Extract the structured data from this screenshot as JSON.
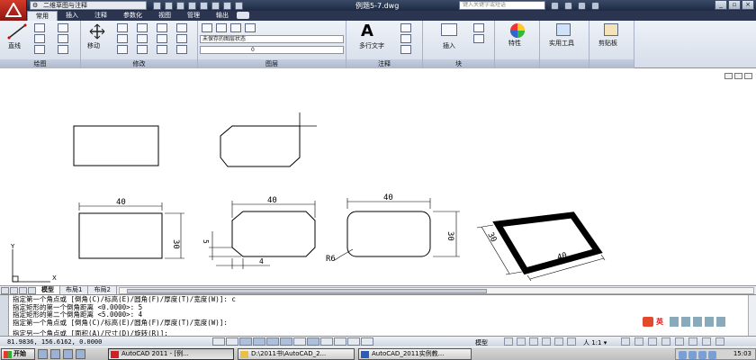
{
  "titlebar": {
    "workspace": "二维草图与注释",
    "document_title": "例题5-7.dwg",
    "search_placeholder": "键入关键字或短语"
  },
  "ribbon_tabs": [
    "常用",
    "插入",
    "注释",
    "参数化",
    "视图",
    "管理",
    "输出"
  ],
  "ribbon": {
    "draw_panel": {
      "label": "绘图",
      "line_label": "直线"
    },
    "modify_panel": {
      "label": "修改",
      "move_label": "移动"
    },
    "layer_panel": {
      "label": "图层",
      "state_combo": "未保存的图层状态",
      "layer_combo": "0"
    },
    "annotation_panel": {
      "label": "注释",
      "mtext_label": "多行文字"
    },
    "block_panel": {
      "label": "块",
      "insert_label": "插入"
    },
    "properties_label": "特性",
    "utilities_label": "实用工具",
    "clipboard_label": "剪贴板"
  },
  "drawing": {
    "dim_40_a": "40",
    "dim_30_a": "30",
    "dim_40_b": "40",
    "dim_5": "5",
    "dim_4": "4",
    "dim_40_c": "40",
    "dim_30_c": "30",
    "dim_r6": "R6",
    "dim_30_d": "30",
    "dim_40_d": "40",
    "ucs_x": "X",
    "ucs_y": "Y"
  },
  "layout_tabs": [
    "模型",
    "布局1",
    "布局2"
  ],
  "command_line": {
    "history": [
      "指定第一个角点或 [倒角(C)/标高(E)/圆角(F)/厚度(T)/宽度(W)]: c",
      "指定矩形的第一个倒角距离 <0.0000>: 5",
      "指定矩形的第二个倒角距离 <5.0000>: 4",
      "指定第一个角点或 [倒角(C)/标高(E)/圆角(F)/厚度(T)/宽度(W)]:",
      "指定另一个角点或 [面积(A)/尺寸(D)/旋转(R)]:"
    ],
    "ime_label": "英"
  },
  "statusbar": {
    "coords": "81.9836,  156.6162, 0.0000",
    "model_label": "模型",
    "scale_label": "人 1:1 ▾"
  },
  "taskbar": {
    "start_label": "开始",
    "tasks": [
      "AutoCAD 2011 - [例...",
      "D:\\2011书\\AutoCAD_2...",
      "AutoCAD_2011实例教..."
    ],
    "clock": "15:03"
  },
  "colors": {
    "title_bg": "#1c2a44",
    "ribbon_bg": "#d6dde9",
    "canvas_bg": "#ffffff",
    "accent_red": "#d23a2a"
  }
}
